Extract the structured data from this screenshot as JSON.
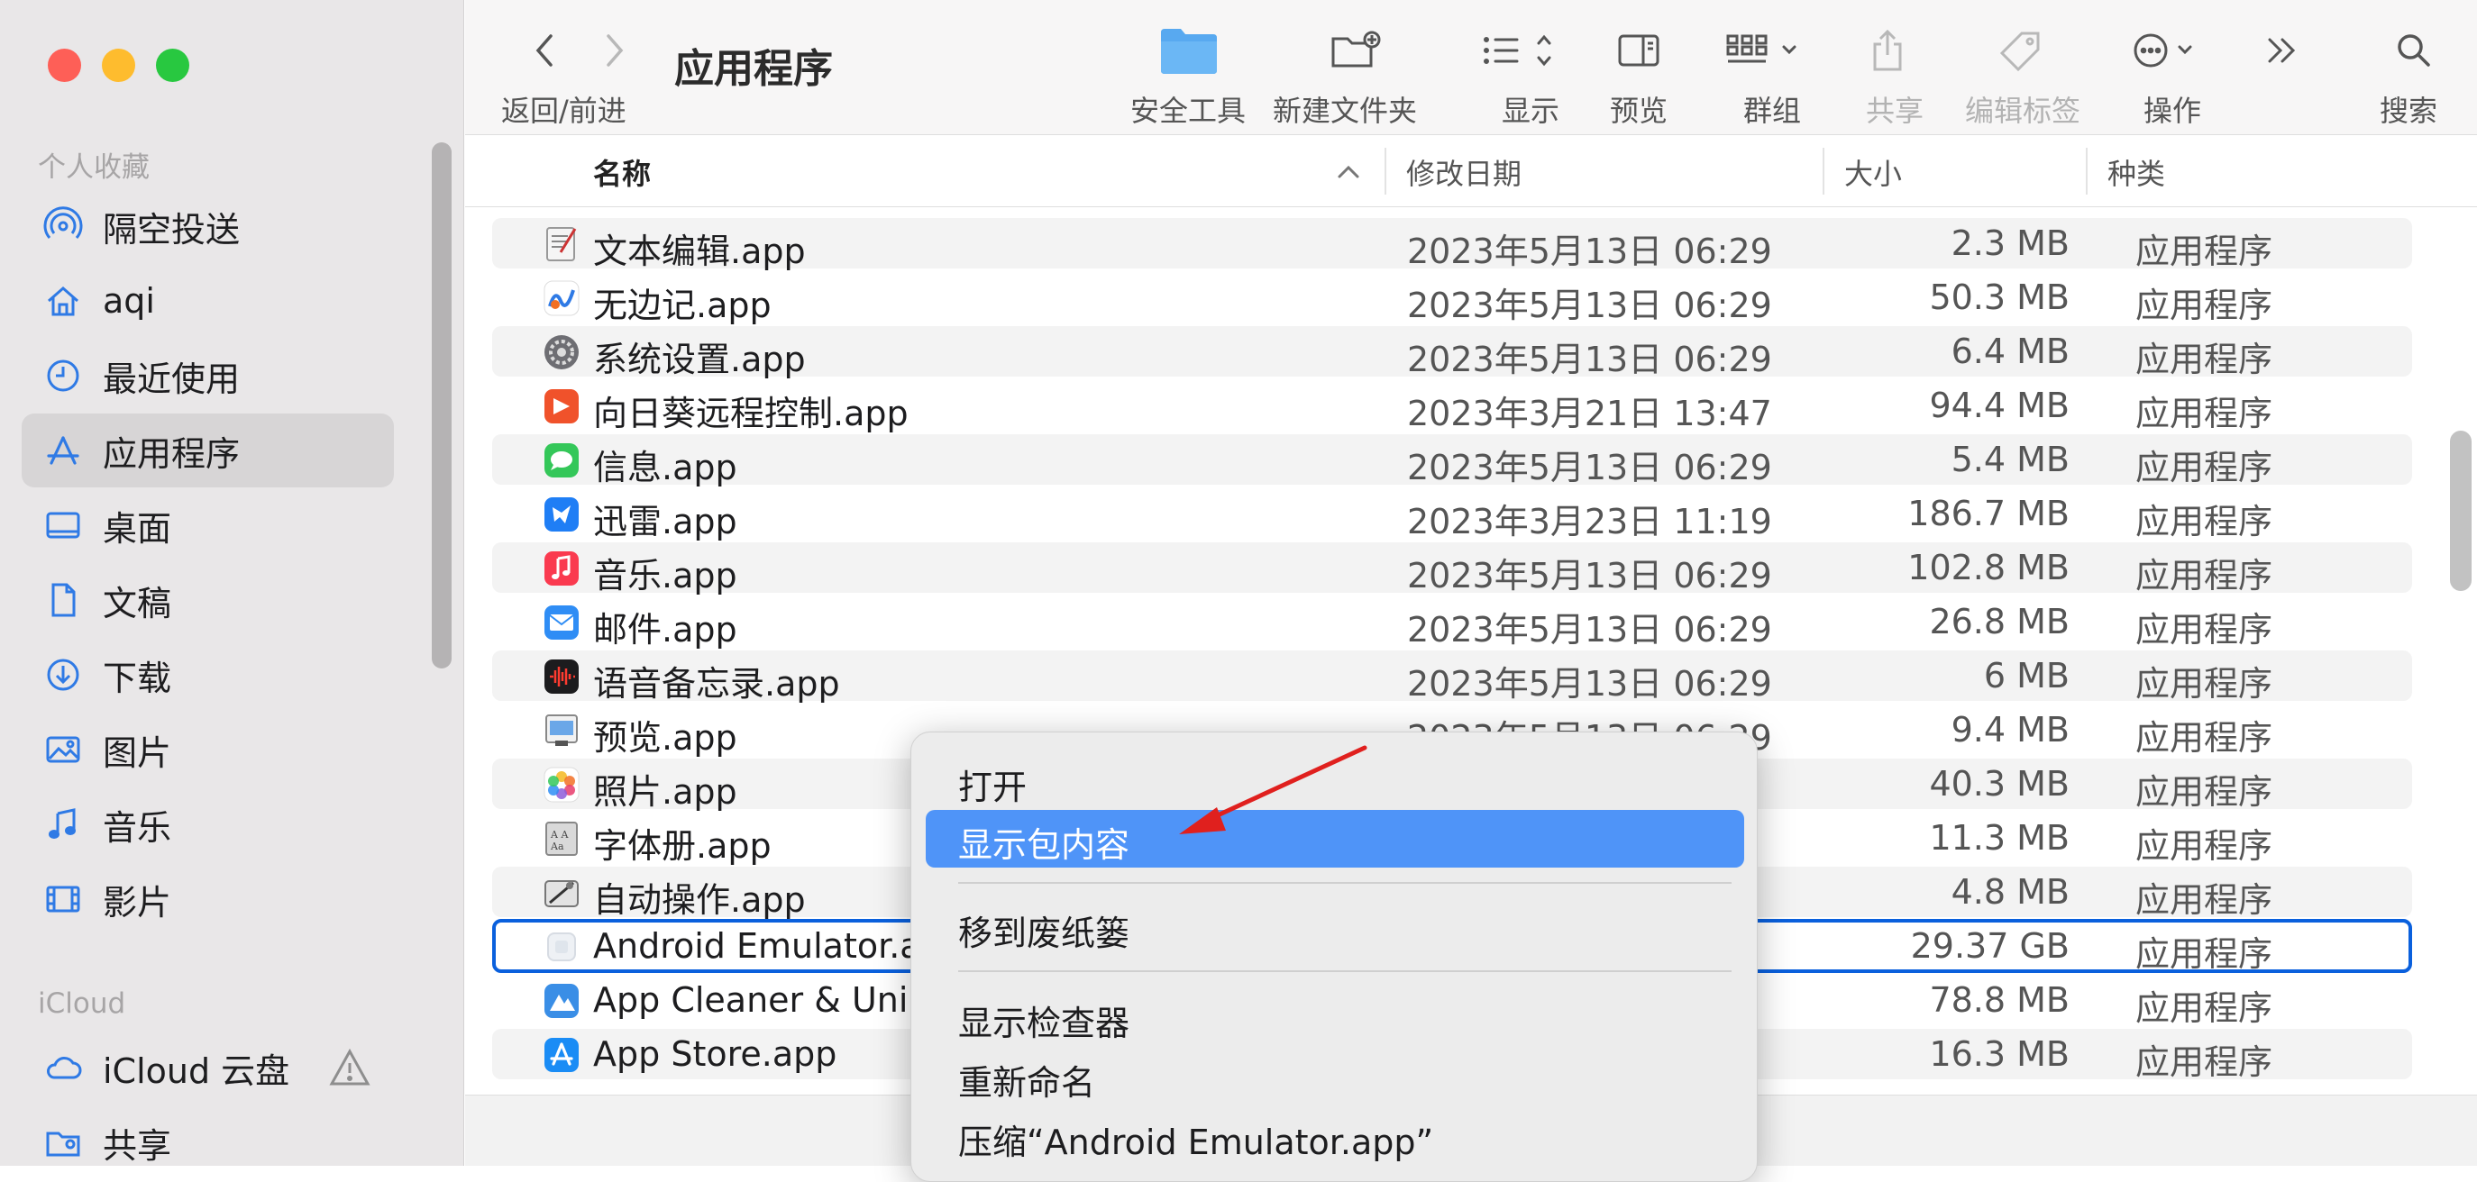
{
  "window": {
    "title": "应用程序"
  },
  "sidebar": {
    "favorites_label": "个人收藏",
    "icloud_label": "iCloud",
    "items": [
      {
        "label": "隔空投送",
        "icon": "airdrop-icon"
      },
      {
        "label": "aqi",
        "icon": "home-icon"
      },
      {
        "label": "最近使用",
        "icon": "clock-icon"
      },
      {
        "label": "应用程序",
        "icon": "applications-icon"
      },
      {
        "label": "桌面",
        "icon": "desktop-icon"
      },
      {
        "label": "文稿",
        "icon": "document-icon"
      },
      {
        "label": "下载",
        "icon": "download-icon"
      },
      {
        "label": "图片",
        "icon": "photo-icon"
      },
      {
        "label": "音乐",
        "icon": "music-note-icon"
      },
      {
        "label": "影片",
        "icon": "film-icon"
      }
    ],
    "icloud_items": [
      {
        "label": "iCloud 云盘",
        "icon": "cloud-icon"
      },
      {
        "label": "共享",
        "icon": "shared-folder-icon"
      }
    ]
  },
  "toolbar": {
    "back_forward": "返回/前进",
    "security": "安全工具",
    "new_folder": "新建文件夹",
    "view": "显示",
    "preview": "预览",
    "group": "群组",
    "share": "共享",
    "edit_tags": "编辑标签",
    "action": "操作",
    "search": "搜索"
  },
  "columns": {
    "name": "名称",
    "date": "修改日期",
    "size": "大小",
    "kind": "种类"
  },
  "files": [
    {
      "name": "文本编辑.app",
      "date": "2023年5月13日 06:29",
      "size": "2.3 MB",
      "kind": "应用程序",
      "icon_color": "#f2f2f2"
    },
    {
      "name": "无边记.app",
      "date": "2023年5月13日 06:29",
      "size": "50.3 MB",
      "kind": "应用程序",
      "icon_color": "#ffffff"
    },
    {
      "name": "系统设置.app",
      "date": "2023年5月13日 06:29",
      "size": "6.4 MB",
      "kind": "应用程序",
      "icon_color": "#6e6e73"
    },
    {
      "name": "向日葵远程控制.app",
      "date": "2023年3月21日 13:47",
      "size": "94.4 MB",
      "kind": "应用程序",
      "icon_color": "#f0522b"
    },
    {
      "name": "信息.app",
      "date": "2023年5月13日 06:29",
      "size": "5.4 MB",
      "kind": "应用程序",
      "icon_color": "#34c759"
    },
    {
      "name": "迅雷.app",
      "date": "2023年3月23日 11:19",
      "size": "186.7 MB",
      "kind": "应用程序",
      "icon_color": "#1f7ef5"
    },
    {
      "name": "音乐.app",
      "date": "2023年5月13日 06:29",
      "size": "102.8 MB",
      "kind": "应用程序",
      "icon_color": "#fa3a4f"
    },
    {
      "name": "邮件.app",
      "date": "2023年5月13日 06:29",
      "size": "26.8 MB",
      "kind": "应用程序",
      "icon_color": "#2f8df5"
    },
    {
      "name": "语音备忘录.app",
      "date": "2023年5月13日 06:29",
      "size": "6 MB",
      "kind": "应用程序",
      "icon_color": "#1c1c1e"
    },
    {
      "name": "预览.app",
      "date": "2023年5月13日 06:29",
      "size": "9.4 MB",
      "kind": "应用程序",
      "icon_color": "#6aa7e8"
    },
    {
      "name": "照片.app",
      "date": "",
      "size": "40.3 MB",
      "kind": "应用程序",
      "icon_color": "#f6c342"
    },
    {
      "name": "字体册.app",
      "date": "",
      "size": "11.3 MB",
      "kind": "应用程序",
      "icon_color": "#9c9c9c"
    },
    {
      "name": "自动操作.app",
      "date": "",
      "size": "4.8 MB",
      "kind": "应用程序",
      "icon_color": "#8c8c8c"
    },
    {
      "name": "Android Emulator.app",
      "date": "",
      "size": "29.37 GB",
      "kind": "应用程序",
      "icon_color": "#e6eaf0",
      "selected": true
    },
    {
      "name": "App Cleaner & Uninstaller.app",
      "date": "",
      "size": "78.8 MB",
      "kind": "应用程序",
      "icon_color": "#3a8ee6"
    },
    {
      "name": "App Store.app",
      "date": "",
      "size": "16.3 MB",
      "kind": "应用程序",
      "icon_color": "#1a8cf5"
    },
    {
      "name": "",
      "date": "",
      "size": "",
      "kind": "",
      "icon_color": "#ffffff"
    }
  ],
  "context_menu": {
    "open": "打开",
    "show_package_contents": "显示包内容",
    "move_to_trash": "移到废纸篓",
    "show_inspector": "显示检查器",
    "rename": "重新命名",
    "compress": "压缩“Android Emulator.app”"
  },
  "colors": {
    "sidebar_bg": "#e9e7e8",
    "sidebar_icon": "#2f7ae5",
    "selection_border": "#0a60dd",
    "menu_highlight": "#4f94f8",
    "annotation_arrow": "#e0201e"
  }
}
